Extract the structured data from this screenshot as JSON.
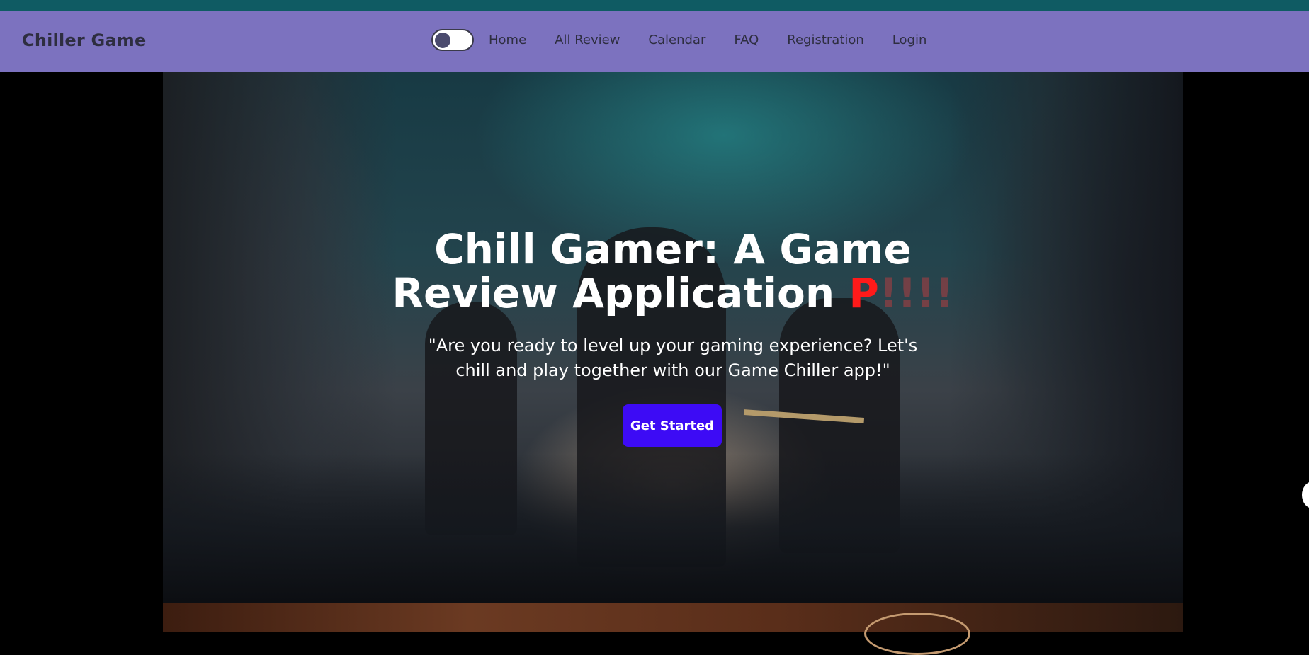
{
  "navbar": {
    "brand": "Chiller Game",
    "theme_toggle": {
      "state": "off"
    },
    "links": [
      "Home",
      "All Review",
      "Calendar",
      "FAQ",
      "Registration",
      "Login"
    ]
  },
  "hero": {
    "title_line1": "Chill Gamer: A Game",
    "title_line2": "Review Application ",
    "title_accent": "P",
    "title_accent_fade": "!!!!",
    "subtitle": "\"Are you ready to level up your gaming experience? Let's chill and play together with our Game Chiller app!\"",
    "cta_label": "Get Started"
  },
  "colors": {
    "top_strip": "#0f5b63",
    "navbar": "#7c72bf",
    "cta": "#3d0bf5",
    "title_accent": "#ff1a1a"
  }
}
